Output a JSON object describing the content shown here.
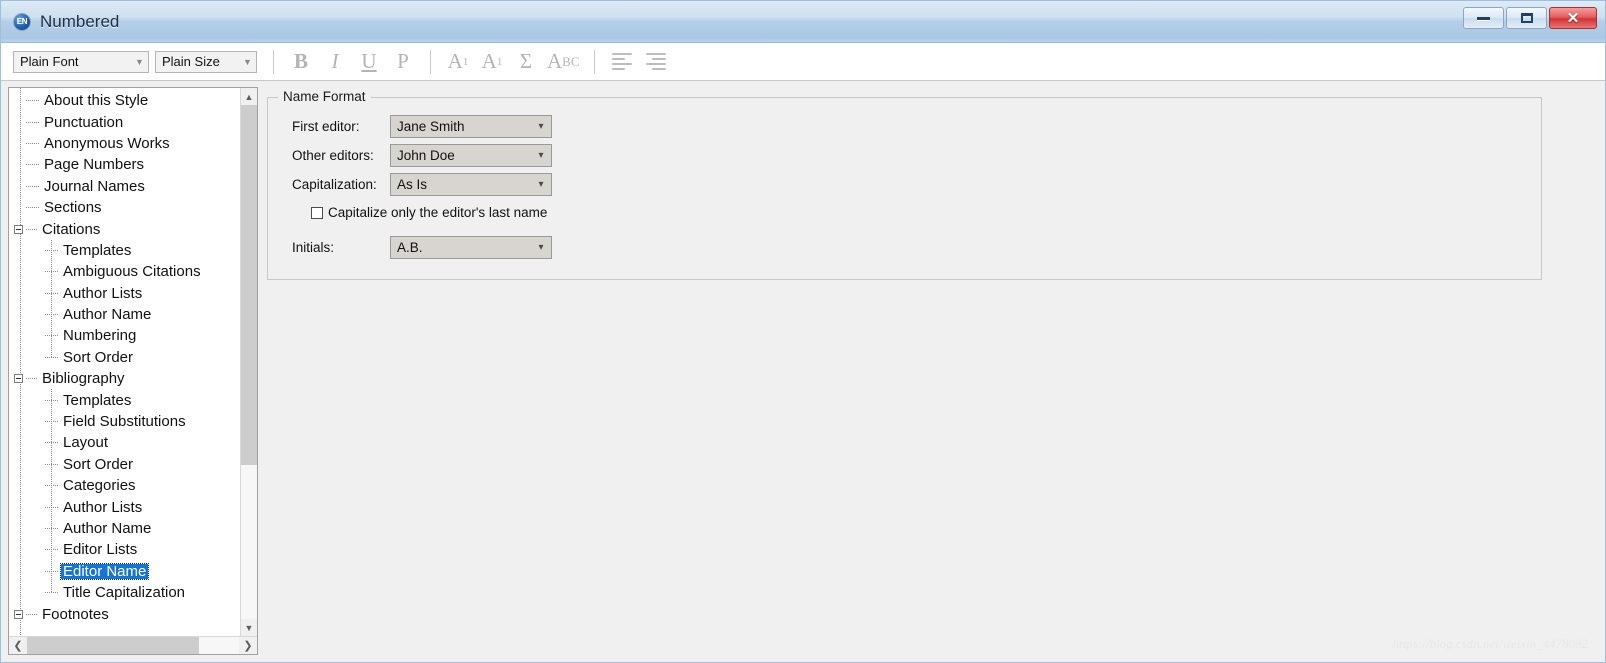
{
  "window": {
    "title": "Numbered",
    "app_icon": "endnote-icon",
    "icon_label": "EN",
    "controls": {
      "minimize": "Minimize",
      "maximize": "Maximize",
      "close": "Close"
    }
  },
  "toolbar": {
    "font_combo": {
      "value": "Plain Font"
    },
    "size_combo": {
      "value": "Plain Size"
    },
    "buttons": [
      {
        "name": "bold-button",
        "label": "B"
      },
      {
        "name": "italic-button",
        "label": "I"
      },
      {
        "name": "underline-button",
        "label": "U"
      },
      {
        "name": "plain-button",
        "label": "P"
      },
      {
        "name": "superscript-button",
        "label": "A",
        "script": "1"
      },
      {
        "name": "subscript-button",
        "label": "A",
        "script": "1"
      },
      {
        "name": "symbol-button",
        "label": "Σ"
      },
      {
        "name": "small-caps-button",
        "label": "A",
        "script": "BC"
      },
      {
        "name": "align-left-button",
        "label": ""
      },
      {
        "name": "align-right-button",
        "label": ""
      }
    ]
  },
  "tree": {
    "selected": "Editor Name",
    "nodes": [
      {
        "label": "About this Style",
        "level": 1,
        "expander": "none"
      },
      {
        "label": "Punctuation",
        "level": 1,
        "expander": "none"
      },
      {
        "label": "Anonymous Works",
        "level": 1,
        "expander": "none"
      },
      {
        "label": "Page Numbers",
        "level": 1,
        "expander": "none"
      },
      {
        "label": "Journal Names",
        "level": 1,
        "expander": "none"
      },
      {
        "label": "Sections",
        "level": 1,
        "expander": "none"
      },
      {
        "label": "Citations",
        "level": 0,
        "expander": "minus"
      },
      {
        "label": "Templates",
        "level": 2,
        "expander": "none"
      },
      {
        "label": "Ambiguous Citations",
        "level": 2,
        "expander": "none"
      },
      {
        "label": "Author Lists",
        "level": 2,
        "expander": "none"
      },
      {
        "label": "Author Name",
        "level": 2,
        "expander": "none"
      },
      {
        "label": "Numbering",
        "level": 2,
        "expander": "none"
      },
      {
        "label": "Sort Order",
        "level": 2,
        "expander": "none"
      },
      {
        "label": "Bibliography",
        "level": 0,
        "expander": "minus"
      },
      {
        "label": "Templates",
        "level": 2,
        "expander": "none"
      },
      {
        "label": "Field Substitutions",
        "level": 2,
        "expander": "none"
      },
      {
        "label": "Layout",
        "level": 2,
        "expander": "none"
      },
      {
        "label": "Sort Order",
        "level": 2,
        "expander": "none"
      },
      {
        "label": "Categories",
        "level": 2,
        "expander": "none"
      },
      {
        "label": "Author Lists",
        "level": 2,
        "expander": "none"
      },
      {
        "label": "Author Name",
        "level": 2,
        "expander": "none"
      },
      {
        "label": "Editor Lists",
        "level": 2,
        "expander": "none"
      },
      {
        "label": "Editor Name",
        "level": 2,
        "expander": "none",
        "selected": true
      },
      {
        "label": "Title Capitalization",
        "level": 2,
        "expander": "none"
      },
      {
        "label": "Footnotes",
        "level": 0,
        "expander": "minus"
      }
    ],
    "scroll": {
      "up_arrow": "ⱏ",
      "down_arrow": "ⱞ",
      "left_arrow": "‹",
      "right_arrow": "›"
    }
  },
  "name_format": {
    "group_title": "Name Format",
    "fields": [
      {
        "label": "First editor:",
        "value": "Jane Smith"
      },
      {
        "label": "Other editors:",
        "value": "John Doe"
      },
      {
        "label": "Capitalization:",
        "value": "As Is"
      }
    ],
    "checkbox": {
      "label": "Capitalize only the editor's last name",
      "checked": false
    },
    "initials": {
      "label": "Initials:",
      "value": "A.B."
    }
  },
  "watermark": {
    "text": "https://blog.csdn.net/weixin_4478082"
  },
  "colors": {
    "selection_blue": "#1675d1",
    "titlebar_blue": "#b5cfe8",
    "close_red": "#d23333",
    "combo_gray": "#d8d5d0",
    "panel_gray": "#f0f0f0"
  }
}
